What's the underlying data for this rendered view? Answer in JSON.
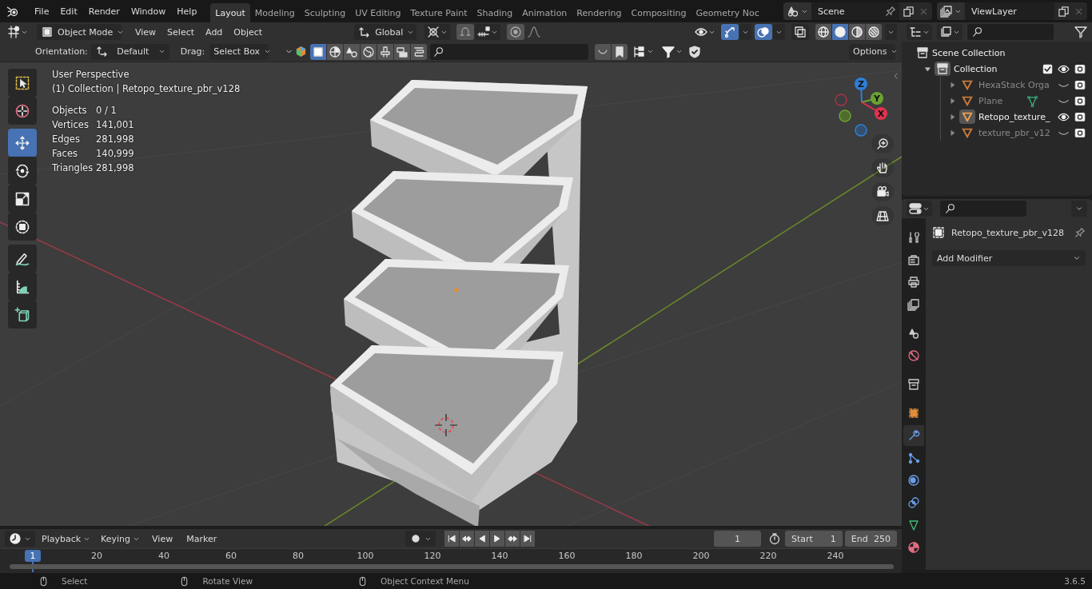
{
  "menu": [
    "File",
    "Edit",
    "Render",
    "Window",
    "Help"
  ],
  "workspaces": [
    {
      "label": "Layout",
      "selected": true
    },
    {
      "label": "Modeling",
      "selected": false
    },
    {
      "label": "Sculpting",
      "selected": false
    },
    {
      "label": "UV Editing",
      "selected": false
    },
    {
      "label": "Texture Paint",
      "selected": false
    },
    {
      "label": "Shading",
      "selected": false
    },
    {
      "label": "Animation",
      "selected": false
    },
    {
      "label": "Rendering",
      "selected": false
    },
    {
      "label": "Compositing",
      "selected": false
    },
    {
      "label": "Geometry Noc",
      "selected": false
    }
  ],
  "scene": {
    "name": "Scene"
  },
  "view_layer": {
    "name": "ViewLayer"
  },
  "viewport_header": {
    "mode": "Object Mode",
    "menus": [
      "View",
      "Select",
      "Add",
      "Object"
    ],
    "orientation": "Global"
  },
  "shading": [
    {
      "kind": "wireframe",
      "selected": false
    },
    {
      "kind": "solid",
      "selected": true
    },
    {
      "kind": "material",
      "selected": false
    },
    {
      "kind": "rendered",
      "selected": false
    }
  ],
  "tool_settings": {
    "orientation_label": "Orientation:",
    "orientation": "Default",
    "drag_label": "Drag:",
    "drag": "Select Box",
    "options": "Options"
  },
  "tools": [
    {
      "kind": "select_box",
      "selected": false
    },
    {
      "kind": "cursor",
      "selected": false
    },
    {
      "kind": "move",
      "selected": true
    },
    {
      "kind": "rotate",
      "selected": false
    },
    {
      "kind": "scale",
      "selected": false
    },
    {
      "kind": "transform",
      "selected": false
    },
    {
      "kind": "annotate",
      "selected": false
    },
    {
      "kind": "measure",
      "selected": false
    },
    {
      "kind": "add_cube",
      "selected": false
    }
  ],
  "viewport_info": {
    "perspective": "User Perspective",
    "context": "(1) Collection | Retopo_texture_pbr_v128",
    "stats": [
      {
        "label": "Objects",
        "value": "0 / 1"
      },
      {
        "label": "Vertices",
        "value": "141,001"
      },
      {
        "label": "Edges",
        "value": "281,998"
      },
      {
        "label": "Faces",
        "value": "140,999"
      },
      {
        "label": "Triangles",
        "value": "281,998"
      }
    ]
  },
  "gizmo": {
    "axes": [
      "Z",
      "Y",
      "X"
    ]
  },
  "outliner": {
    "root": "Scene Collection",
    "collection": {
      "name": "Collection",
      "expanded": true,
      "checked": true,
      "children": [
        {
          "name": "HexaStack Orga",
          "expanded": false,
          "active": false,
          "visible": false,
          "mesh_data": false
        },
        {
          "name": "Plane",
          "expanded": false,
          "active": false,
          "visible": false,
          "mesh_data": true
        },
        {
          "name": "Retopo_texture_",
          "expanded": false,
          "active": true,
          "visible": true,
          "mesh_data": false
        },
        {
          "name": "texture_pbr_v12",
          "expanded": false,
          "active": false,
          "visible": false,
          "mesh_data": false
        }
      ]
    }
  },
  "properties": {
    "object": "Retopo_texture_pbr_v128",
    "add_modifier": "Add Modifier",
    "tabs": [
      {
        "kind": "tool",
        "selected": false
      },
      {
        "kind": "render",
        "selected": false
      },
      {
        "kind": "output",
        "selected": false
      },
      {
        "kind": "view_layer",
        "selected": false
      },
      {
        "kind": "scene",
        "selected": false
      },
      {
        "kind": "world",
        "selected": false
      },
      {
        "kind": "collection",
        "selected": false
      },
      {
        "kind": "object",
        "selected": false
      },
      {
        "kind": "modifiers",
        "selected": true
      },
      {
        "kind": "particles",
        "selected": false
      },
      {
        "kind": "physics",
        "selected": false
      },
      {
        "kind": "constraints",
        "selected": false
      },
      {
        "kind": "data",
        "selected": false
      },
      {
        "kind": "material",
        "selected": false
      }
    ]
  },
  "timeline": {
    "menus": [
      "Playback",
      "Keying",
      "View",
      "Marker"
    ],
    "current_frame": "1",
    "start_label": "Start",
    "start": "1",
    "end_label": "End",
    "end": "250",
    "playhead": "1",
    "ruler": [
      "20",
      "40",
      "60",
      "80",
      "100",
      "120",
      "140",
      "160",
      "180",
      "200",
      "220",
      "240"
    ]
  },
  "status_bar": {
    "hints": [
      "Select",
      "Rotate View",
      "Object Context Menu"
    ],
    "version": "3.6.5"
  }
}
